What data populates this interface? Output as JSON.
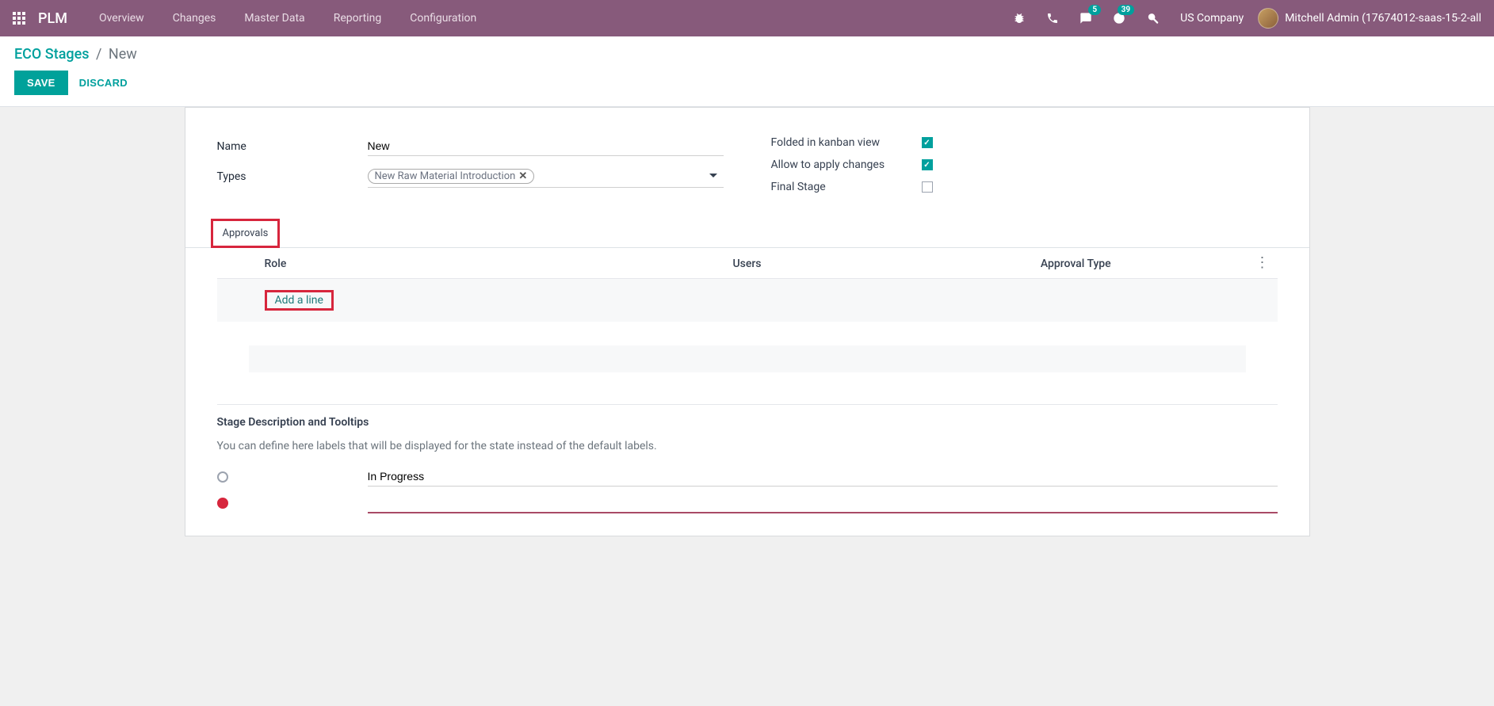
{
  "navbar": {
    "brand": "PLM",
    "menu": [
      "Overview",
      "Changes",
      "Master Data",
      "Reporting",
      "Configuration"
    ],
    "messages_badge": "5",
    "activities_badge": "39",
    "company": "US Company",
    "user": "Mitchell Admin (17674012-saas-15-2-all"
  },
  "breadcrumb": {
    "parent": "ECO Stages",
    "current": "New"
  },
  "buttons": {
    "save": "SAVE",
    "discard": "DISCARD"
  },
  "form": {
    "name_label": "Name",
    "name_value": "New",
    "types_label": "Types",
    "types_tag": "New Raw Material Introduction",
    "folded_label": "Folded in kanban view",
    "folded_checked": true,
    "allow_label": "Allow to apply changes",
    "allow_checked": true,
    "final_label": "Final Stage",
    "final_checked": false
  },
  "tabs": {
    "approvals": "Approvals"
  },
  "table": {
    "role": "Role",
    "users": "Users",
    "approval_type": "Approval Type",
    "add_line": "Add a line"
  },
  "desc": {
    "title": "Stage Description and Tooltips",
    "help": "You can define here labels that will be displayed for the state instead of the default labels.",
    "state1": "In Progress",
    "state2": ""
  }
}
